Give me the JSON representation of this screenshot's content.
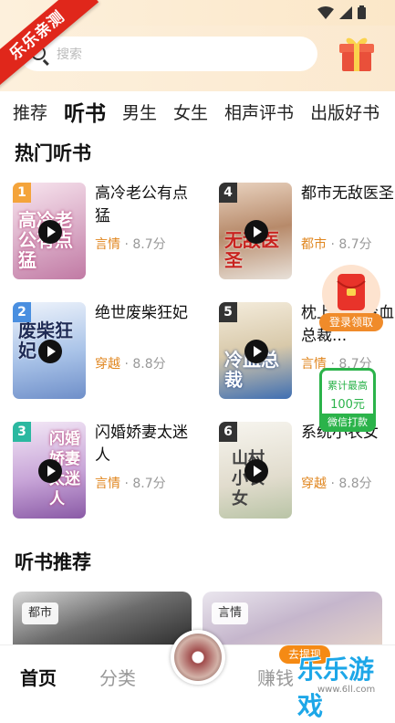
{
  "status": {
    "icons": [
      "wifi-icon",
      "signal-icon",
      "battery-icon"
    ]
  },
  "brand": {
    "ribbon": "乐乐亲测"
  },
  "search": {
    "hint": "搜索"
  },
  "tabs": [
    "推荐",
    "听书",
    "男生",
    "女生",
    "相声评书",
    "出版好书"
  ],
  "active_tab": "听书",
  "hot": {
    "title": "热门听书",
    "books": [
      {
        "rank": "1",
        "title": "高冷老公有点猛",
        "tag": "言情",
        "score": "8.7分",
        "cover_text": "高冷老公有点猛",
        "rank_color": "#f4a43b"
      },
      {
        "rank": "4",
        "title": "都市无敌医圣",
        "tag": "都市",
        "score": "8.7分",
        "cover_text": "无敌医圣",
        "rank_color": "#333"
      },
      {
        "rank": "2",
        "title": "绝世废柴狂妃",
        "tag": "穿越",
        "score": "8.8分",
        "cover_text": "废柴狂妃",
        "rank_color": "#4a8fe0"
      },
      {
        "rank": "5",
        "title": "枕上欢：冷血总裁...",
        "tag": "言情",
        "score": "8.7分",
        "cover_text": "冷血总裁",
        "rank_color": "#333"
      },
      {
        "rank": "3",
        "title": "闪婚娇妻太迷人",
        "tag": "言情",
        "score": "8.7分",
        "cover_text": "闪婚娇妻太迷人",
        "rank_color": "#2bb8a0"
      },
      {
        "rank": "6",
        "title": "系统小农女",
        "tag": "穿越",
        "score": "8.8分",
        "cover_text": "山村小农女",
        "rank_color": "#333"
      }
    ]
  },
  "rec": {
    "title": "听书推荐",
    "cards": [
      {
        "tag": "都市"
      },
      {
        "tag": "言情"
      }
    ]
  },
  "float": {
    "redpack_label": "登录领取",
    "reward_l1": "累计最高",
    "reward_l2": "100元",
    "reward_btn": "微信打款"
  },
  "nav": {
    "home": "首页",
    "category": "分类",
    "earn": "赚钱",
    "withdraw": "去提现"
  },
  "watermark": {
    "text": "乐乐游戏",
    "url": "www.6ll.com"
  }
}
